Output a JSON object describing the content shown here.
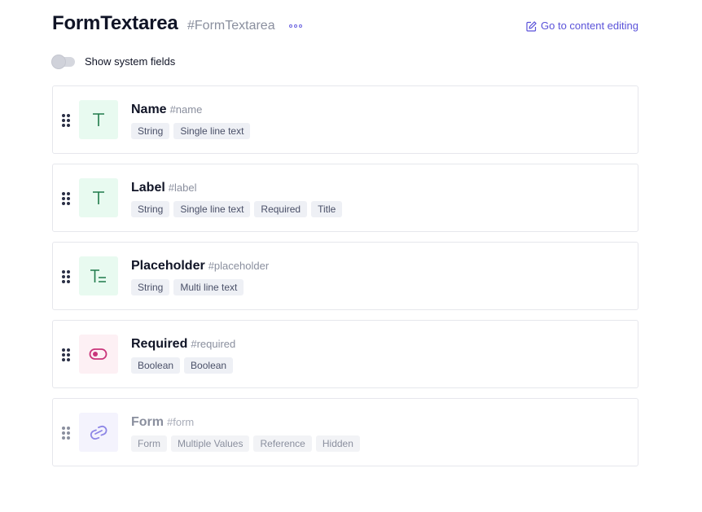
{
  "header": {
    "title": "FormTextarea",
    "api_id": "#FormTextarea",
    "more_icon": "more-horizontal-icon",
    "goto_label": "Go to content editing",
    "goto_icon": "edit-icon"
  },
  "system_fields": {
    "label": "Show system fields",
    "enabled": false
  },
  "colors": {
    "accent": "#5a52d9",
    "string_icon": "#1f7a4a",
    "boolean_icon": "#c9347a",
    "reference_icon": "#8d86e6"
  },
  "fields": [
    {
      "name": "Name",
      "api_id": "#name",
      "icon": "text-t-icon",
      "tags": [
        "String",
        "Single line text"
      ]
    },
    {
      "name": "Label",
      "api_id": "#label",
      "icon": "text-t-icon",
      "tags": [
        "String",
        "Single line text",
        "Required",
        "Title"
      ]
    },
    {
      "name": "Placeholder",
      "api_id": "#placeholder",
      "icon": "multiline-text-icon",
      "tags": [
        "String",
        "Multi line text"
      ]
    },
    {
      "name": "Required",
      "api_id": "#required",
      "icon": "toggle-icon",
      "tags": [
        "Boolean",
        "Boolean"
      ]
    },
    {
      "name": "Form",
      "api_id": "#form",
      "icon": "link-icon",
      "tags": [
        "Form",
        "Multiple Values",
        "Reference",
        "Hidden"
      ]
    }
  ]
}
